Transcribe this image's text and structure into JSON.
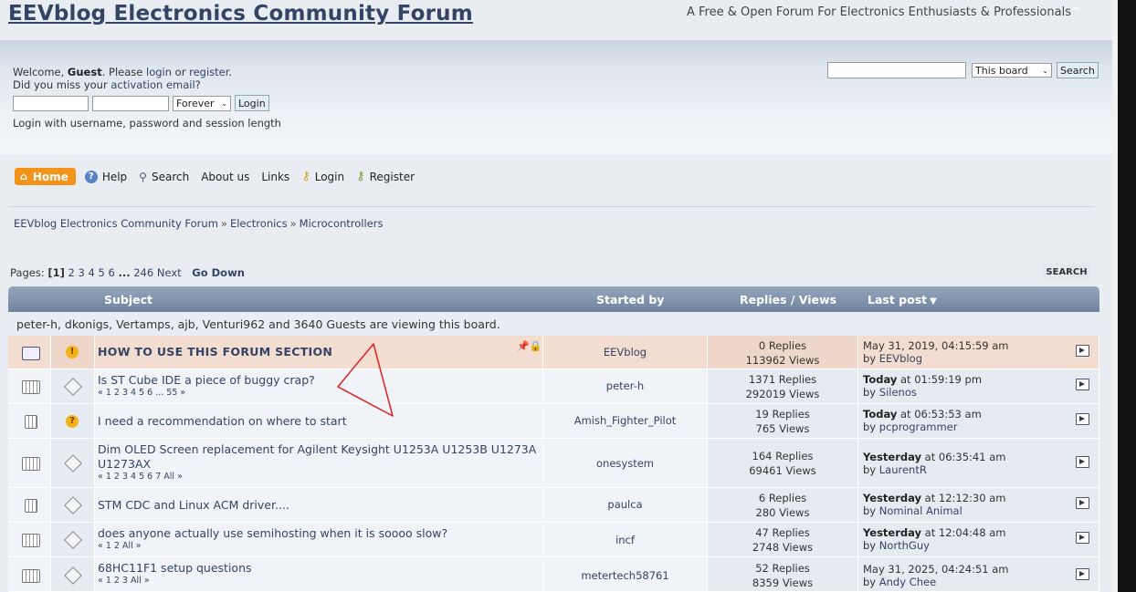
{
  "forum_title": "EEVblog Electronics Community Forum",
  "tagline": "A Free & Open Forum For Electronics Enthusiasts & Professionals",
  "welcome": {
    "prefix": "Welcome, ",
    "user": "Guest",
    "mid": ". Please ",
    "login_link": "login",
    "or": " or ",
    "register_link": "register",
    "end": ".",
    "line2_prefix": "Did you miss your ",
    "activation_link": "activation email",
    "line2_end": "?"
  },
  "login": {
    "duration": "Forever",
    "button": "Login",
    "hint": "Login with username, password and session length"
  },
  "search": {
    "scope": "This board",
    "button": "Search"
  },
  "menu": {
    "home": "Home",
    "help": "Help",
    "search": "Search",
    "about": "About us",
    "links": "Links",
    "login": "Login",
    "register": "Register"
  },
  "breadcrumb": [
    "EEVblog Electronics Community Forum",
    "Electronics",
    "Microcontrollers"
  ],
  "pagination": {
    "label": "Pages:",
    "current": "[1]",
    "pages": [
      "2",
      "3",
      "4",
      "5",
      "6",
      "...",
      "246"
    ],
    "next": "Next",
    "go_down": "Go Down",
    "search_button": "SEARCH"
  },
  "table": {
    "headers": {
      "subject": "Subject",
      "started_by": "Started by",
      "replies_views": "Replies / Views",
      "last_post": "Last post"
    },
    "viewers": "peter-h, dkonigs, Vertamps, ajb, Venturi962 and 3640 Guests are viewing this board.",
    "rows": [
      {
        "subject": "HOW TO USE THIS FORUM SECTION",
        "pages": "",
        "starter": "EEVblog",
        "replies": "0 Replies",
        "views": "113962 Views",
        "last_date_bold": "",
        "last_date": "May 31, 2019, 04:15:59 am",
        "last_by": "EEVblog"
      },
      {
        "subject": "Is ST Cube IDE a piece of buggy crap?",
        "pages": "« 1 2 3 4 5 6 ... 55 »",
        "starter": "peter-h",
        "replies": "1371 Replies",
        "views": "292019 Views",
        "last_date_bold": "Today",
        "last_date": " at 01:59:19 pm",
        "last_by": "Silenos"
      },
      {
        "subject": "I need a recommendation on where to start",
        "pages": "",
        "starter": "Amish_Fighter_Pilot",
        "replies": "19 Replies",
        "views": "765 Views",
        "last_date_bold": "Today",
        "last_date": " at 06:53:53 am",
        "last_by": "pcprogrammer"
      },
      {
        "subject": "Dim OLED Screen replacement for Agilent Keysight U1253A U1253B U1273A U1273AX",
        "pages": "« 1 2 3 4 5 6 7  All »",
        "starter": "onesystem",
        "replies": "164 Replies",
        "views": "69461 Views",
        "last_date_bold": "Yesterday",
        "last_date": " at 06:35:41 am",
        "last_by": "LaurentR"
      },
      {
        "subject": "STM CDC and Linux ACM driver....",
        "pages": "",
        "starter": "paulca",
        "replies": "6 Replies",
        "views": "280 Views",
        "last_date_bold": "Yesterday",
        "last_date": " at 12:12:30 am",
        "last_by": "Nominal Animal"
      },
      {
        "subject": "does anyone actually use semihosting when it is soooo slow?",
        "pages": "« 1 2  All »",
        "starter": "incf",
        "replies": "47 Replies",
        "views": "2748 Views",
        "last_date_bold": "Yesterday",
        "last_date": " at 12:04:48 am",
        "last_by": "NorthGuy"
      },
      {
        "subject": "68HC11F1 setup questions",
        "pages": "« 1 2 3  All »",
        "starter": "metertech58761",
        "replies": "52 Replies",
        "views": "8359 Views",
        "last_date_bold": "",
        "last_date": "May 31, 2025, 04:24:51 am",
        "last_by": "Andy Chee"
      }
    ]
  },
  "by_prefix": "by "
}
